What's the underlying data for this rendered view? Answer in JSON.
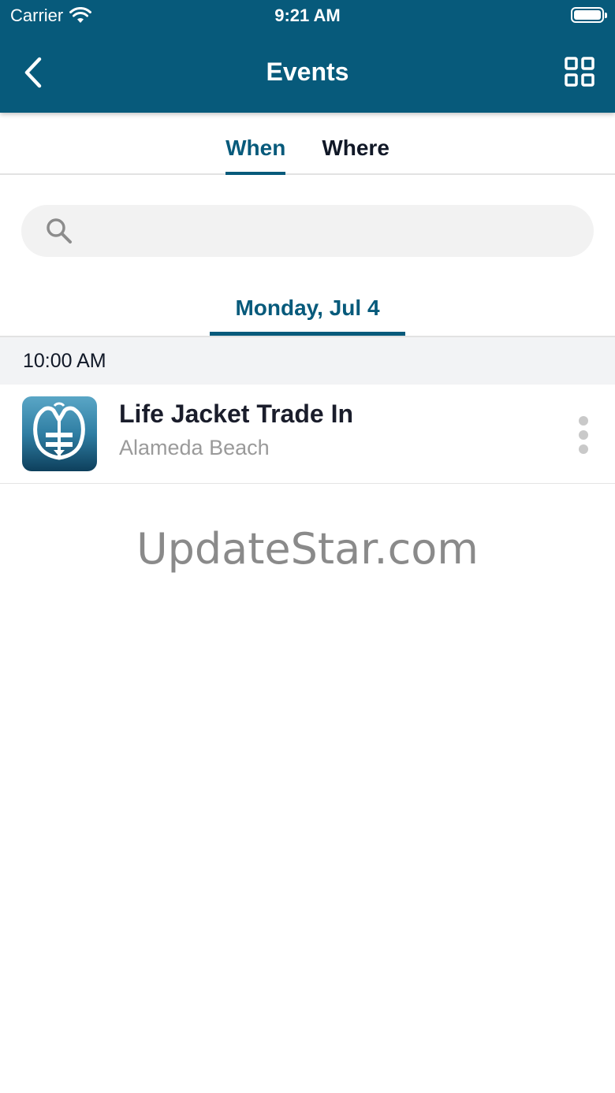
{
  "status_bar": {
    "carrier": "Carrier",
    "time": "9:21 AM"
  },
  "nav": {
    "title": "Events",
    "back_icon": "chevron-left-icon",
    "grid_icon": "grid-icon"
  },
  "tabs": [
    {
      "label": "When",
      "active": true
    },
    {
      "label": "Where",
      "active": false
    }
  ],
  "search": {
    "placeholder": "",
    "value": ""
  },
  "date_tab": {
    "label": "Monday, Jul 4"
  },
  "sections": [
    {
      "time": "10:00 AM",
      "events": [
        {
          "title": "Life Jacket Trade In",
          "location": "Alameda Beach",
          "thumbnail_icon": "life-jacket-icon"
        }
      ]
    }
  ],
  "watermark": "UpdateStar.com",
  "colors": {
    "primary": "#075a7b",
    "section_bg": "#f2f3f5",
    "muted_text": "#9a9a9a"
  }
}
